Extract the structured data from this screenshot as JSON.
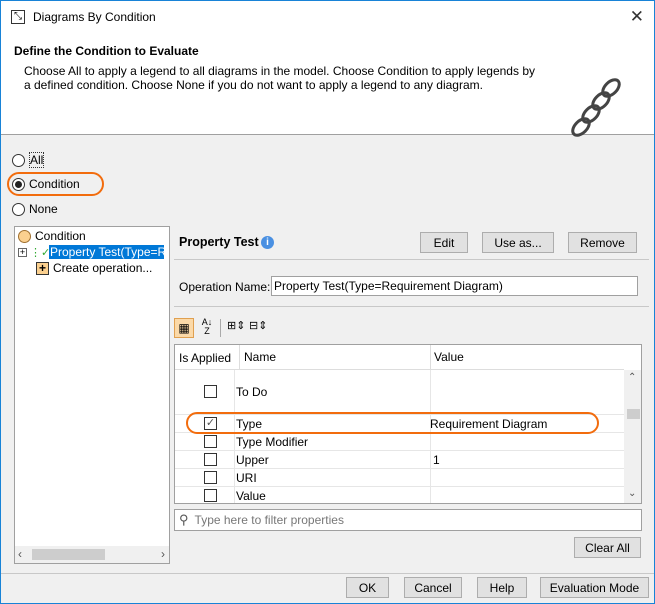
{
  "window": {
    "title": "Diagrams By Condition"
  },
  "header": {
    "title": "Define the Condition to Evaluate",
    "description": "Choose All to apply a legend to all diagrams in the model. Choose Condition to apply legends by a defined condition. Choose None if you do not want to apply a legend to any diagram."
  },
  "options": [
    {
      "label": "All",
      "selected": false
    },
    {
      "label": "Condition",
      "selected": true
    },
    {
      "label": "None",
      "selected": false
    }
  ],
  "tree": {
    "root": "Condition",
    "items": [
      "Property Test(Type=Re",
      "Create operation..."
    ]
  },
  "panel": {
    "title": "Property Test",
    "edit": "Edit",
    "use_as": "Use as...",
    "remove": "Remove",
    "op_name_label": "Operation Name:",
    "op_name_value": "Property Test(Type=Requirement Diagram)"
  },
  "table": {
    "headers": [
      "Is Applied",
      "Name",
      "Value"
    ],
    "rows": [
      {
        "checked": false,
        "name": "To Do",
        "value": ""
      },
      {
        "checked": true,
        "name": "Type",
        "value": "Requirement Diagram"
      },
      {
        "checked": false,
        "name": "Type Modifier",
        "value": ""
      },
      {
        "checked": false,
        "name": "Upper",
        "value": "1"
      },
      {
        "checked": false,
        "name": "URI",
        "value": ""
      },
      {
        "checked": false,
        "name": "Value",
        "value": ""
      }
    ]
  },
  "filter": {
    "placeholder": "Type here to filter properties"
  },
  "clear_all": "Clear All",
  "footer": {
    "ok": "OK",
    "cancel": "Cancel",
    "help": "Help",
    "eval": "Evaluation Mode"
  }
}
